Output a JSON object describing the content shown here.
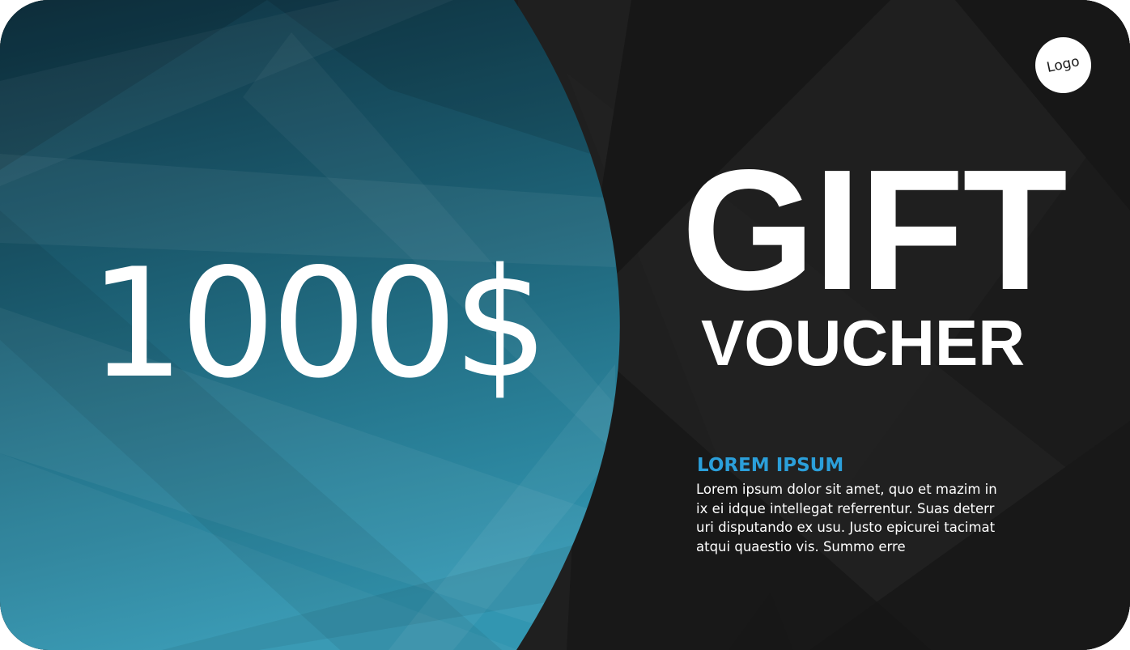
{
  "voucher": {
    "amount": "1000$",
    "title": "GIFT",
    "subtitle": "VOUCHER",
    "heading": "LOREM IPSUM",
    "body_lines": [
      "Lorem ipsum dolor sit amet, quo et mazim in",
      "ix ei idque intellegat referrentur. Suas deterr",
      "uri disputando ex usu. Justo epicurei tacimat",
      "atqui quaestio vis. Summo erre"
    ],
    "logo_text": "Logo"
  },
  "colors": {
    "panel_dark": "#1b1b1b",
    "panel_teal_top": "#11394a",
    "panel_teal_bottom": "#2f93ad",
    "heading_accent": "#2b9fda",
    "text": "#ffffff"
  }
}
